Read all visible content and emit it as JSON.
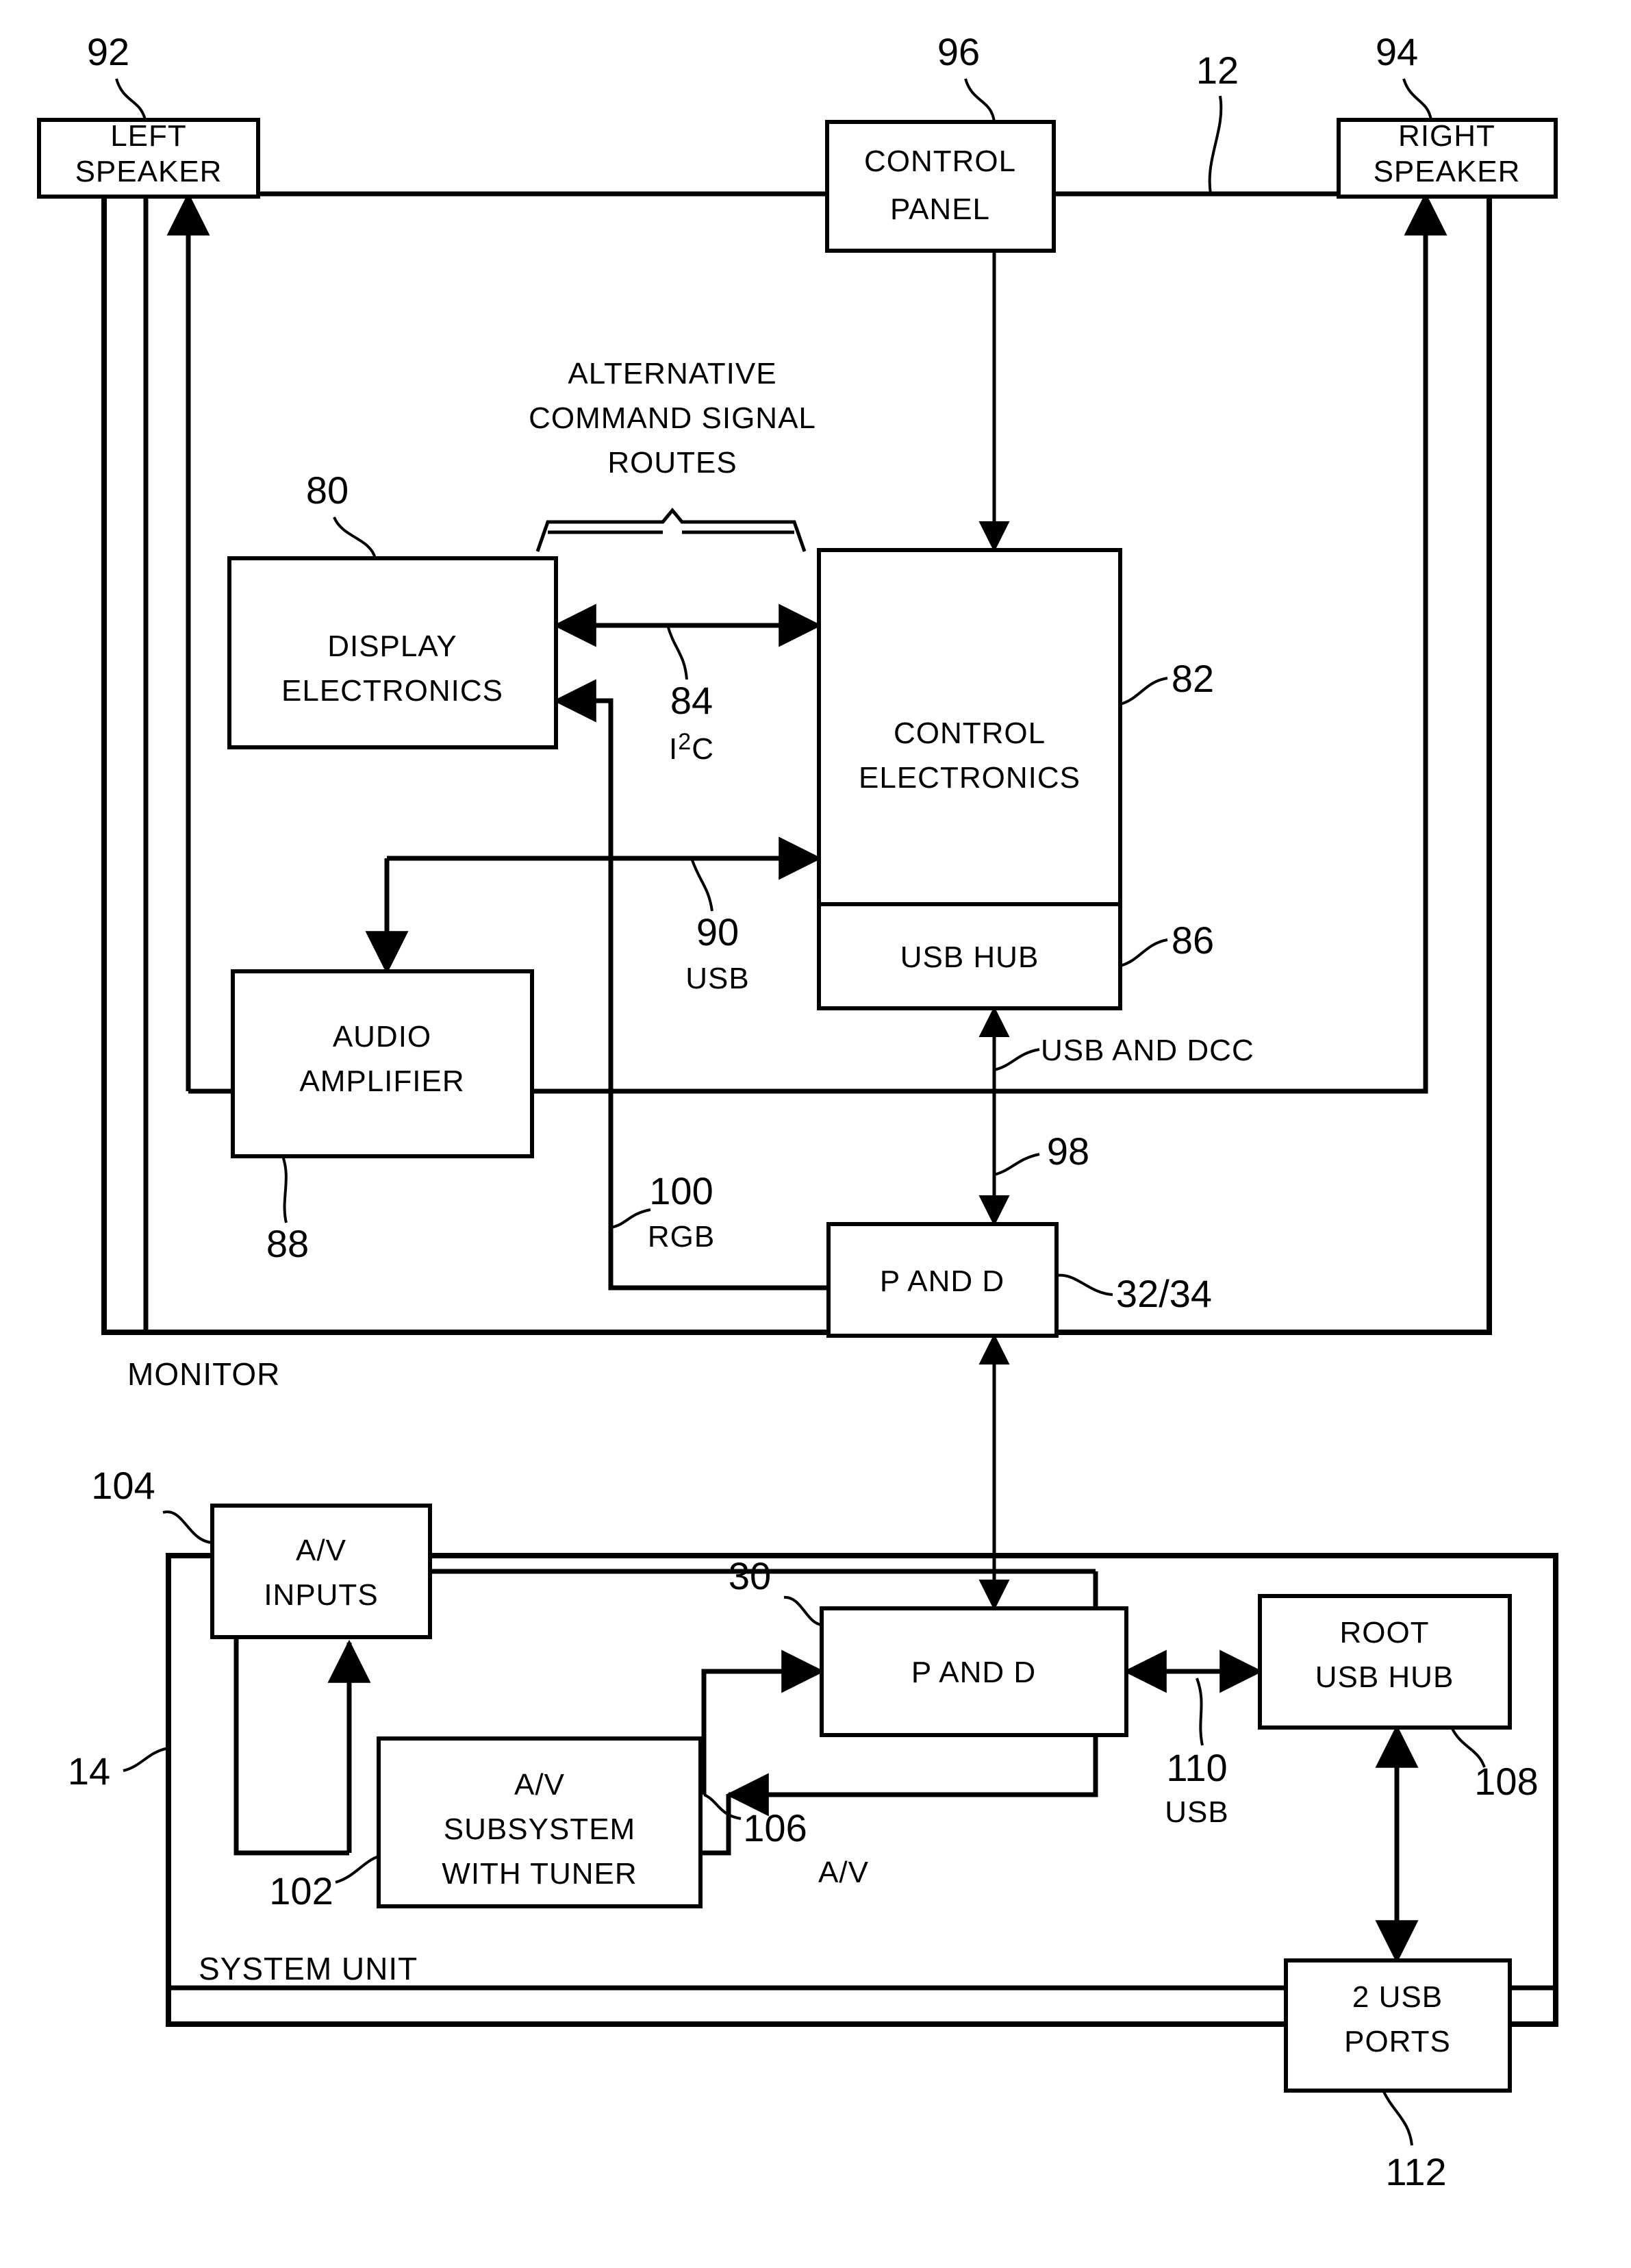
{
  "figure": {
    "type": "patent-block-diagram",
    "background_color": "#ffffff",
    "line_color": "#000000"
  },
  "enclosures": [
    {
      "id": "monitor",
      "label": "MONITOR",
      "ref": ""
    },
    {
      "id": "system_unit",
      "label": "SYSTEM UNIT",
      "ref": "14"
    }
  ],
  "blocks": {
    "left_speaker": {
      "line1": "LEFT",
      "line2": "SPEAKER",
      "ref": "92"
    },
    "control_panel": {
      "line1": "CONTROL",
      "line2": "PANEL",
      "ref": "96"
    },
    "right_speaker": {
      "line1": "RIGHT",
      "line2": "SPEAKER",
      "ref": "94"
    },
    "display_electronics": {
      "line1": "DISPLAY",
      "line2": "ELECTRONICS",
      "ref": "80"
    },
    "control_electronics": {
      "line1": "CONTROL",
      "line2": "ELECTRONICS",
      "ref": "82"
    },
    "usb_hub": {
      "line1": "USB HUB",
      "line2": "",
      "ref": "86"
    },
    "audio_amplifier": {
      "line1": "AUDIO",
      "line2": "AMPLIFIER",
      "ref": "88"
    },
    "monitor_pand": {
      "line1": "P AND D",
      "line2": "",
      "ref": "32/34"
    },
    "av_inputs": {
      "line1": "A/V",
      "line2": "INPUTS",
      "ref": "104"
    },
    "system_pand": {
      "line1": "P AND D",
      "line2": "",
      "ref": "30"
    },
    "root_usb_hub": {
      "line1": "ROOT",
      "line2": "USB HUB",
      "ref": "108"
    },
    "av_subsystem": {
      "line1": "A/V",
      "line2": "SUBSYSTEM",
      "line3": "WITH TUNER",
      "ref": "102"
    },
    "usb_ports": {
      "line1": "2 USB",
      "line2": "PORTS",
      "ref": "112"
    }
  },
  "annotations": {
    "alt_routes_l1": "ALTERNATIVE",
    "alt_routes_l2": "COMMAND SIGNAL",
    "alt_routes_l3": "ROUTES",
    "ref_12": "12",
    "ref_84": "84",
    "bus_84_name_base": "I",
    "bus_84_name_sup": "2",
    "bus_84_name_tail": "C",
    "ref_90": "90",
    "bus_90_name": "USB",
    "ref_100": "100",
    "bus_100_name": "RGB",
    "usb_and_dcc": "USB AND DCC",
    "ref_98": "98",
    "ref_106": "106",
    "bus_106_name": "A/V",
    "ref_110": "110",
    "bus_110_name": "USB"
  }
}
